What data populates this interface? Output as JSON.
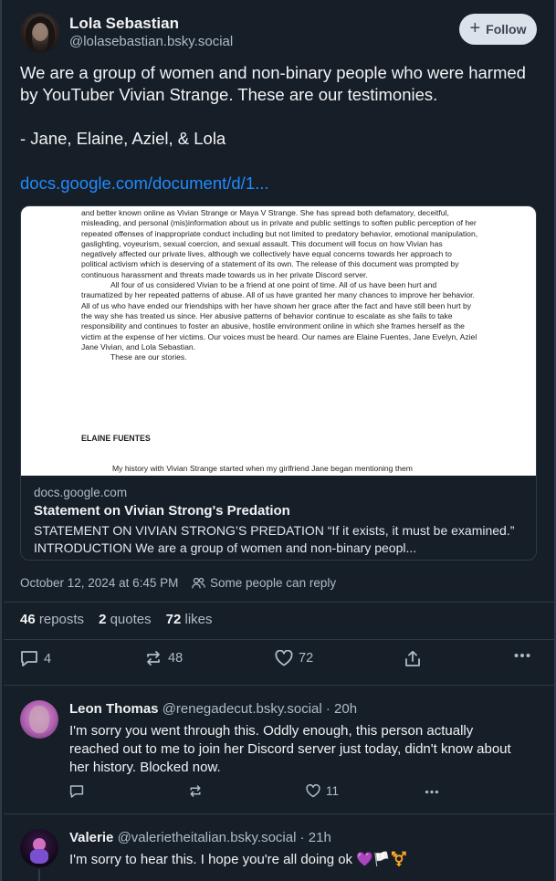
{
  "post": {
    "author_name": "Lola Sebastian",
    "author_handle": "@lolasebastian.bsky.social",
    "follow_label": "Follow",
    "text": "We are a group of women and non-binary people who were harmed by YouTuber Vivian Strange. These are our testimonies.",
    "signature": "- Jane, Elaine, Aziel, & Lola",
    "link_text": "docs.google.com/document/d/1..."
  },
  "card": {
    "doc_p1": "and better known online as Vivian Strange or Maya V Strange. She has spread both defamatory, deceitful, misleading, and personal (mis)information about us in private and public settings to soften public perception of her repeated offenses of inappropriate conduct including but not limited to predatory behavior, emotional manipulation, gaslighting, voyeurism, sexual coercion, and sexual assault. This document will focus on how Vivian has negatively affected our private lives, although we collectively have equal concerns towards her approach to political activism which is deserving of a statement of its own. The release of this document was prompted by continuous harassment and threats made towards us in her private Discord server.",
    "doc_p2": "All four of us considered Vivian to be a friend at one point of time. All of us have been hurt and traumatized by her repeated patterns of abuse. All of us have granted her many chances to improve her behavior. All of us who have ended our friendships with her have shown her grace after the fact and have still been hurt by the way she has treated us since. Her abusive patterns of behavior continue to escalate as she fails to take responsibility and continues to foster an abusive, hostile environment online in which she frames herself as the victim at the expense of her victims. Our voices must be heard. Our names are Elaine Fuentes, Jane Evelyn, Aziel Jane Vivian, and Lola Sebastian.",
    "doc_p3": "These are our stories.",
    "doc_heading": "ELAINE FUENTES",
    "doc_last": "My history with Vivian Strange started when my girlfriend Jane began mentioning them",
    "domain": "docs.google.com",
    "title": "Statement on Vivian Strong's Predation",
    "description": "STATEMENT ON VIVIAN STRONG’S PREDATION “If it exists, it must be examined.” INTRODUCTION We are a group of women and non-binary peopl..."
  },
  "meta": {
    "date": "October 12, 2024 at 6:45 PM",
    "reply_permission": "Some people can reply"
  },
  "stats": {
    "reposts_count": "46",
    "reposts_label": "reposts",
    "quotes_count": "2",
    "quotes_label": "quotes",
    "likes_count": "72",
    "likes_label": "likes"
  },
  "actions": {
    "reply_count": "4",
    "repost_count": "48",
    "like_count": "72"
  },
  "replies": [
    {
      "name": "Leon Thomas",
      "handle_time": "@renegadecut.bsky.social · 20h",
      "text": "I'm sorry you went through this. Oddly enough, this person actually reached out to me to join her Discord server just today, didn't know about her history. Blocked now.",
      "like_count": "11"
    },
    {
      "name": "Valerie",
      "handle_time": "@valerietheitalian.bsky.social · 21h",
      "text": "I'm sorry to hear this. I hope you're all doing ok 💜🏳️⚧️"
    }
  ],
  "colors": {
    "background": "#161e27",
    "border": "#2e3a47",
    "muted_text": "#aebbc9",
    "link": "#208bfe",
    "follow_bg": "#dce2ea"
  }
}
